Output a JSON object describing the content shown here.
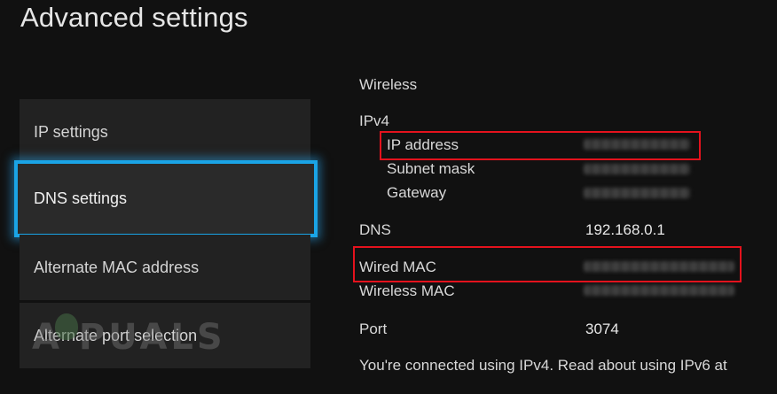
{
  "page_title": "Advanced settings",
  "menu": {
    "items": [
      {
        "label": "IP settings"
      },
      {
        "label": "DNS settings"
      },
      {
        "label": "Alternate MAC address"
      },
      {
        "label": "Alternate port selection"
      }
    ]
  },
  "network": {
    "connection_type": "Wireless",
    "ip_version": "IPv4",
    "ip_address_label": "IP address",
    "subnet_mask_label": "Subnet mask",
    "gateway_label": "Gateway",
    "dns_label": "DNS",
    "dns_value": "192.168.0.1",
    "wired_mac_label": "Wired MAC",
    "wireless_mac_label": "Wireless MAC",
    "port_label": "Port",
    "port_value": "3074",
    "footer_text": "You're connected using IPv4. Read about using IPv6 at"
  },
  "highlight_color": "#e4121d",
  "selection_color": "#1aa4e6",
  "watermark": "A PUALS"
}
